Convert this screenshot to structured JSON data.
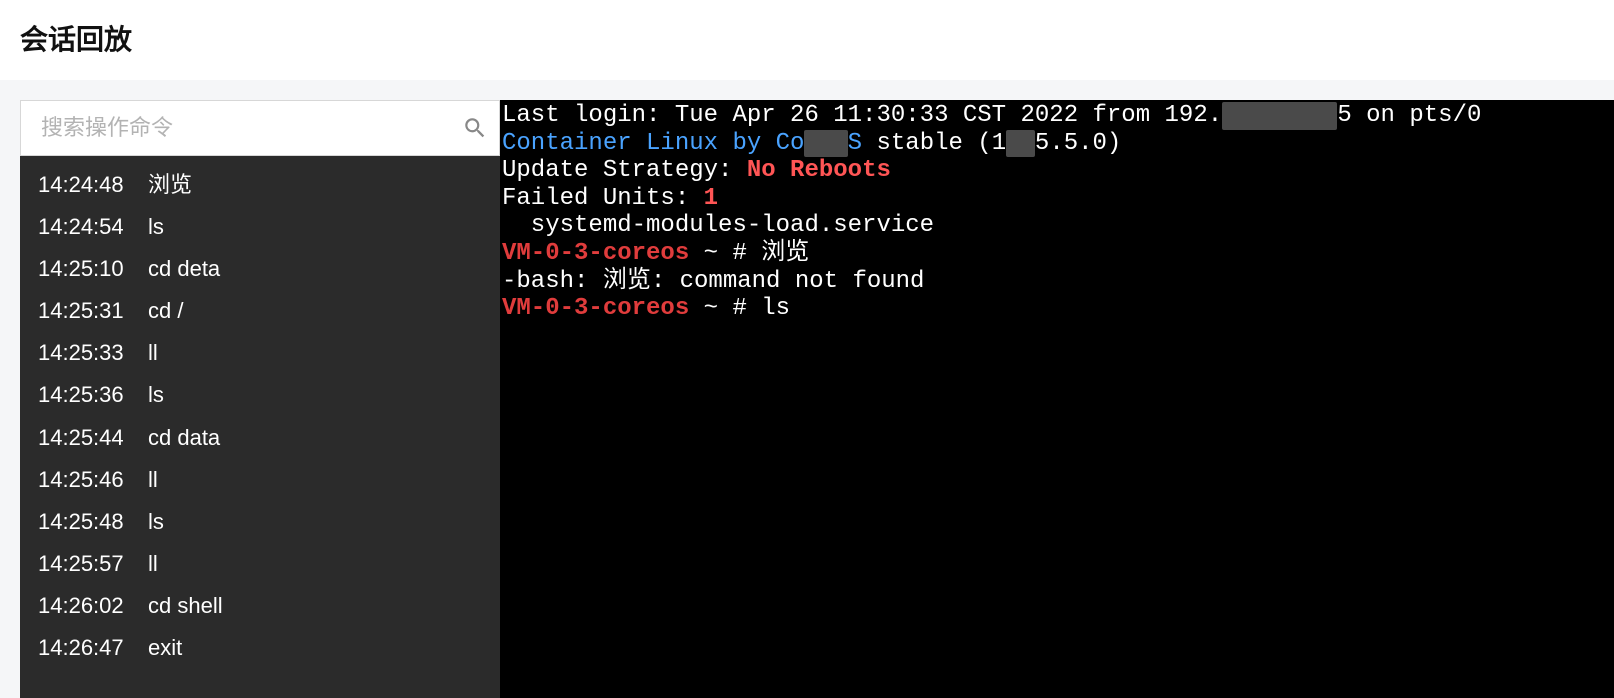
{
  "header": {
    "title": "会话回放"
  },
  "search": {
    "placeholder": "搜索操作命令",
    "value": ""
  },
  "commands": [
    {
      "time": "14:24:48",
      "cmd": "浏览"
    },
    {
      "time": "14:24:54",
      "cmd": "ls"
    },
    {
      "time": "14:25:10",
      "cmd": "cd deta"
    },
    {
      "time": "14:25:31",
      "cmd": "cd /"
    },
    {
      "time": "14:25:33",
      "cmd": "ll"
    },
    {
      "time": "14:25:36",
      "cmd": "ls"
    },
    {
      "time": "14:25:44",
      "cmd": "cd data"
    },
    {
      "time": "14:25:46",
      "cmd": "ll"
    },
    {
      "time": "14:25:48",
      "cmd": "ls"
    },
    {
      "time": "14:25:57",
      "cmd": "ll"
    },
    {
      "time": "14:26:02",
      "cmd": "cd shell"
    },
    {
      "time": "14:26:47",
      "cmd": "exit"
    }
  ],
  "terminal": {
    "line1_a": "Last login: Tue Apr 26 11:30:33 CST 2022 from 192.",
    "line1_redacted": "XXXXXXXX",
    "line1_b": "5 on pts/0",
    "line2_a": "Container Linux by Co",
    "line2_redacted": "XXX",
    "line2_b": "S",
    "line2_c": " stable (1",
    "line2_redacted2": "XX",
    "line2_d": "5.5.0)",
    "line3_a": "Update Strategy: ",
    "line3_b": "No Reboots",
    "line4_a": "Failed Units: ",
    "line4_b": "1",
    "line5": "  systemd-modules-load.service",
    "prompt_host": "VM-0-3-coreos",
    "prompt_sep": " ~ #",
    "cmd1": " 浏览",
    "err1": "-bash: 浏览: command not found",
    "cmd2": " ls"
  }
}
